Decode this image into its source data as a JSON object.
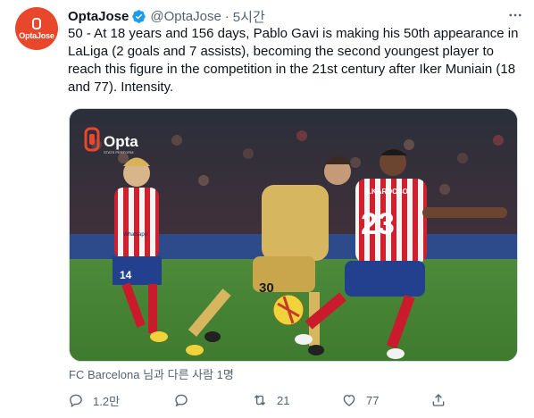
{
  "account": {
    "display_name": "OptaJose",
    "handle": "@OptaJose",
    "time": "5시간",
    "avatar_text": "OptaJose"
  },
  "tweet": {
    "text": "50 - At 18 years and 156 days, Pablo Gavi is making his 50th appearance in LaLiga (2 goals and 7 assists), becoming the second youngest player to reach this figure in the competition in the 21st century after Iker Muniain (18 and 77). Intensity."
  },
  "media": {
    "logo_text": "Opta",
    "logo_sub": "STATS PERFORM",
    "sponsor_text": "Whatsapp",
    "player_left_number": "14",
    "player_center_number": "30",
    "player_right_number": "23",
    "player_right_name": "R.KARDOSO"
  },
  "tag_row": {
    "text": "FC Barcelona 님과 다른 사람 1명"
  },
  "actions": {
    "reply_count": "1.2만",
    "retweet_count": "21",
    "like_count": "77"
  },
  "colors": {
    "opta_orange": "#e8472b",
    "verified_blue": "#1d9bf0",
    "secondary_text": "#536471"
  }
}
